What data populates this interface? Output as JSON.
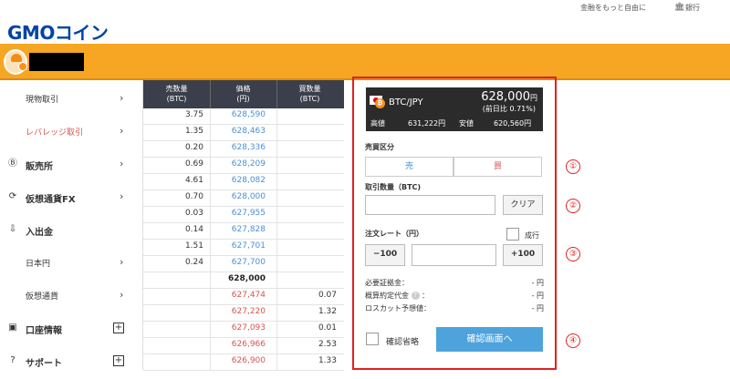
{
  "topbar": {
    "tagline": "金融をもっと自由に",
    "bank": "銀行",
    "bank_icon": "bank-icon"
  },
  "logo": {
    "gmo": "GMO",
    "coin": "コイン"
  },
  "sidebar": {
    "items": [
      {
        "label": "現物取引",
        "icon": "",
        "type": "sub",
        "trail": "›"
      },
      {
        "label": "レバレッジ取引",
        "icon": "",
        "type": "sub-active",
        "trail": "›"
      },
      {
        "label": "販売所",
        "icon": "Ⓑ",
        "type": "main",
        "trail": "›"
      },
      {
        "label": "仮想通貨FX",
        "icon": "⟳",
        "type": "main",
        "trail": "›"
      },
      {
        "label": "入出金",
        "icon": "⇩",
        "type": "main",
        "trail": ""
      },
      {
        "label": "日本円",
        "icon": "",
        "type": "sub",
        "trail": "›"
      },
      {
        "label": "仮想通貨",
        "icon": "",
        "type": "sub",
        "trail": "›"
      },
      {
        "label": "口座情報",
        "icon": "▣",
        "type": "main",
        "trail": "+"
      },
      {
        "label": "サポート",
        "icon": "?",
        "type": "main",
        "trail": "+"
      }
    ]
  },
  "orderbook": {
    "headers": [
      "売数量\n(BTC)",
      "価格\n(円)",
      "買数量\n(BTC)"
    ],
    "rows": [
      {
        "sell": "3.75",
        "price": "628,590",
        "buy": "",
        "side": "ask"
      },
      {
        "sell": "1.35",
        "price": "628,463",
        "buy": "",
        "side": "ask"
      },
      {
        "sell": "0.20",
        "price": "628,336",
        "buy": "",
        "side": "ask"
      },
      {
        "sell": "0.69",
        "price": "628,209",
        "buy": "",
        "side": "ask"
      },
      {
        "sell": "4.61",
        "price": "628,082",
        "buy": "",
        "side": "ask"
      },
      {
        "sell": "0.70",
        "price": "628,000",
        "buy": "",
        "side": "ask"
      },
      {
        "sell": "0.03",
        "price": "627,955",
        "buy": "",
        "side": "ask"
      },
      {
        "sell": "0.14",
        "price": "627,828",
        "buy": "",
        "side": "ask"
      },
      {
        "sell": "1.51",
        "price": "627,701",
        "buy": "",
        "side": "ask"
      },
      {
        "sell": "0.24",
        "price": "627,700",
        "buy": "",
        "side": "ask"
      },
      {
        "sell": "",
        "price": "628,000",
        "buy": "",
        "side": "mid"
      },
      {
        "sell": "",
        "price": "627,474",
        "buy": "0.07",
        "side": "bid"
      },
      {
        "sell": "",
        "price": "627,220",
        "buy": "1.32",
        "side": "bid"
      },
      {
        "sell": "",
        "price": "627,093",
        "buy": "0.01",
        "side": "bid"
      },
      {
        "sell": "",
        "price": "626,966",
        "buy": "2.53",
        "side": "bid"
      },
      {
        "sell": "",
        "price": "626,900",
        "buy": "1.33",
        "side": "bid"
      }
    ]
  },
  "ticker": {
    "pair": "BTC/JPY",
    "price": "628,000",
    "price_unit": "円",
    "change": "(前日比 0.71%)",
    "high_label": "高値",
    "high": "631,222円",
    "low_label": "安値",
    "low": "620,560円"
  },
  "order_form": {
    "side_label": "売買区分",
    "sell": "売",
    "buy": "買",
    "qty_label": "取引数量（BTC)",
    "qty_value": "",
    "clear": "クリア",
    "rate_label": "注文レート（円）",
    "market": "成行",
    "minus": "−100",
    "plus": "+100",
    "rate_value": "",
    "margin_label": "必要証拠金：",
    "margin_value": "- 円",
    "estimate_label": "概算約定代金",
    "estimate_colon": "：",
    "estimate_value": "- 円",
    "losscut_label": "ロスカット予想値：",
    "losscut_value": "- 円",
    "skip_confirm": "確認省略",
    "confirm": "確認画面へ"
  },
  "markers": [
    "①",
    "②",
    "③",
    "④"
  ],
  "colors": {
    "accent_orange": "#f6a623",
    "ask_blue": "#4a90d9",
    "bid_red": "#d9534f",
    "highlight_red": "#e02020",
    "confirm_blue": "#4ea3dc"
  }
}
